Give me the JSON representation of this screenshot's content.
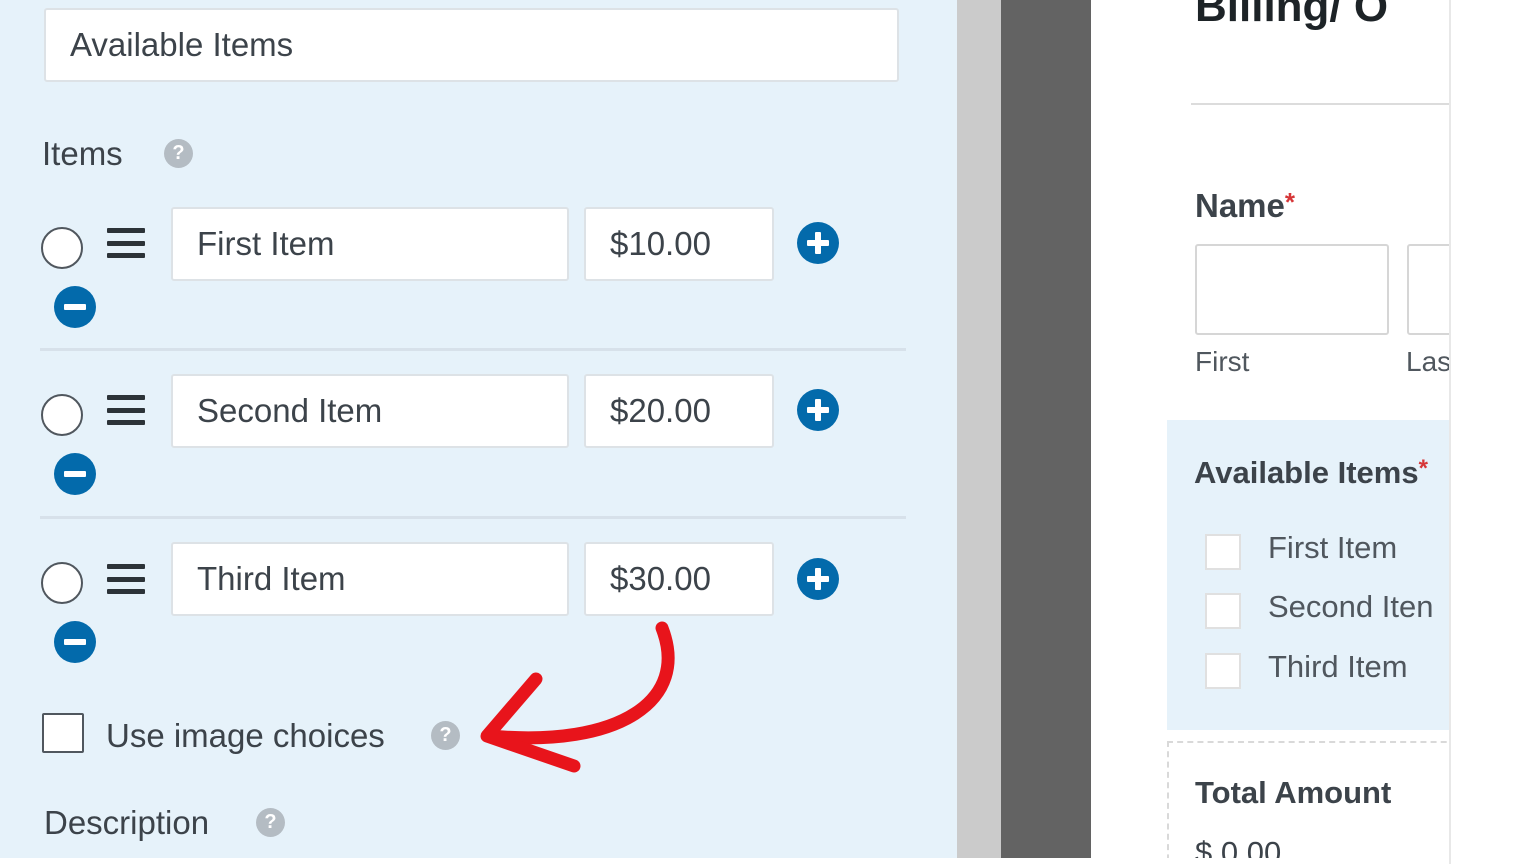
{
  "settings": {
    "field_label_value": "Available Items",
    "items_label": "Items",
    "items": [
      {
        "label": "First Item",
        "price": "$10.00"
      },
      {
        "label": "Second Item",
        "price": "$20.00"
      },
      {
        "label": "Third Item",
        "price": "$30.00"
      }
    ],
    "use_image_choices_label": "Use image choices",
    "description_label": "Description",
    "help_icon_glyph": "?"
  },
  "preview": {
    "form_title": "Billing/ O",
    "name_label": "Name",
    "required_mark": "*",
    "first_sublabel": "First",
    "last_sublabel": "Las",
    "available_items_label": "Available Items",
    "available_items_required": "*",
    "choices": [
      "First Item",
      "Second Iten",
      "Third Item"
    ],
    "total_amount_label": "Total Amount",
    "total_amount_value": "$ 0.00"
  },
  "icons": {
    "help": "question-circle-icon",
    "drag": "drag-handle-icon",
    "add": "plus-circle-icon",
    "remove": "minus-circle-icon",
    "annotation": "red-curved-arrow"
  },
  "colors": {
    "panel_background": "#e6f2fa",
    "action_blue": "#036aab",
    "annotation_red": "#e8141b",
    "required_red": "#d63638"
  }
}
